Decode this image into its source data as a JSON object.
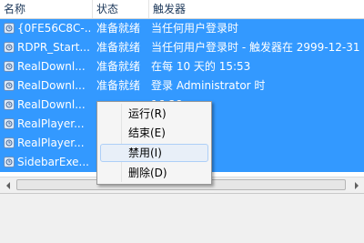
{
  "columns": {
    "name": "名称",
    "status": "状态",
    "trigger": "触发器"
  },
  "tasks": [
    {
      "name": "{0FE56C8C-...",
      "status": "准备就绪",
      "trigger": "当任何用户登录时"
    },
    {
      "name": "RDPR_Start...",
      "status": "准备就绪",
      "trigger": "当任何用户登录时 - 触发器在 2999-12-31 1"
    },
    {
      "name": "RealDownl...",
      "status": "准备就绪",
      "trigger": "在每 10 天的 15:53"
    },
    {
      "name": "RealDownl...",
      "status": "准备就绪",
      "trigger": "登录 Administrator 时"
    },
    {
      "name": "RealDownl...",
      "status": "",
      "trigger": "16:28"
    },
    {
      "name": "RealPlayer...",
      "status": "",
      "trigger": "istrator 时"
    },
    {
      "name": "RealPlayer...",
      "status": "",
      "trigger": "16:27"
    },
    {
      "name": "SidebarExe...",
      "status": "",
      "trigger": "修改任务时"
    }
  ],
  "context_menu": [
    {
      "label": "运行(R)"
    },
    {
      "label": "结束(E)"
    },
    {
      "label": "禁用(I)"
    },
    {
      "label": "删除(D)"
    }
  ],
  "colors": {
    "selection": "#3399ff",
    "menu_hover": "#e8eff8"
  }
}
